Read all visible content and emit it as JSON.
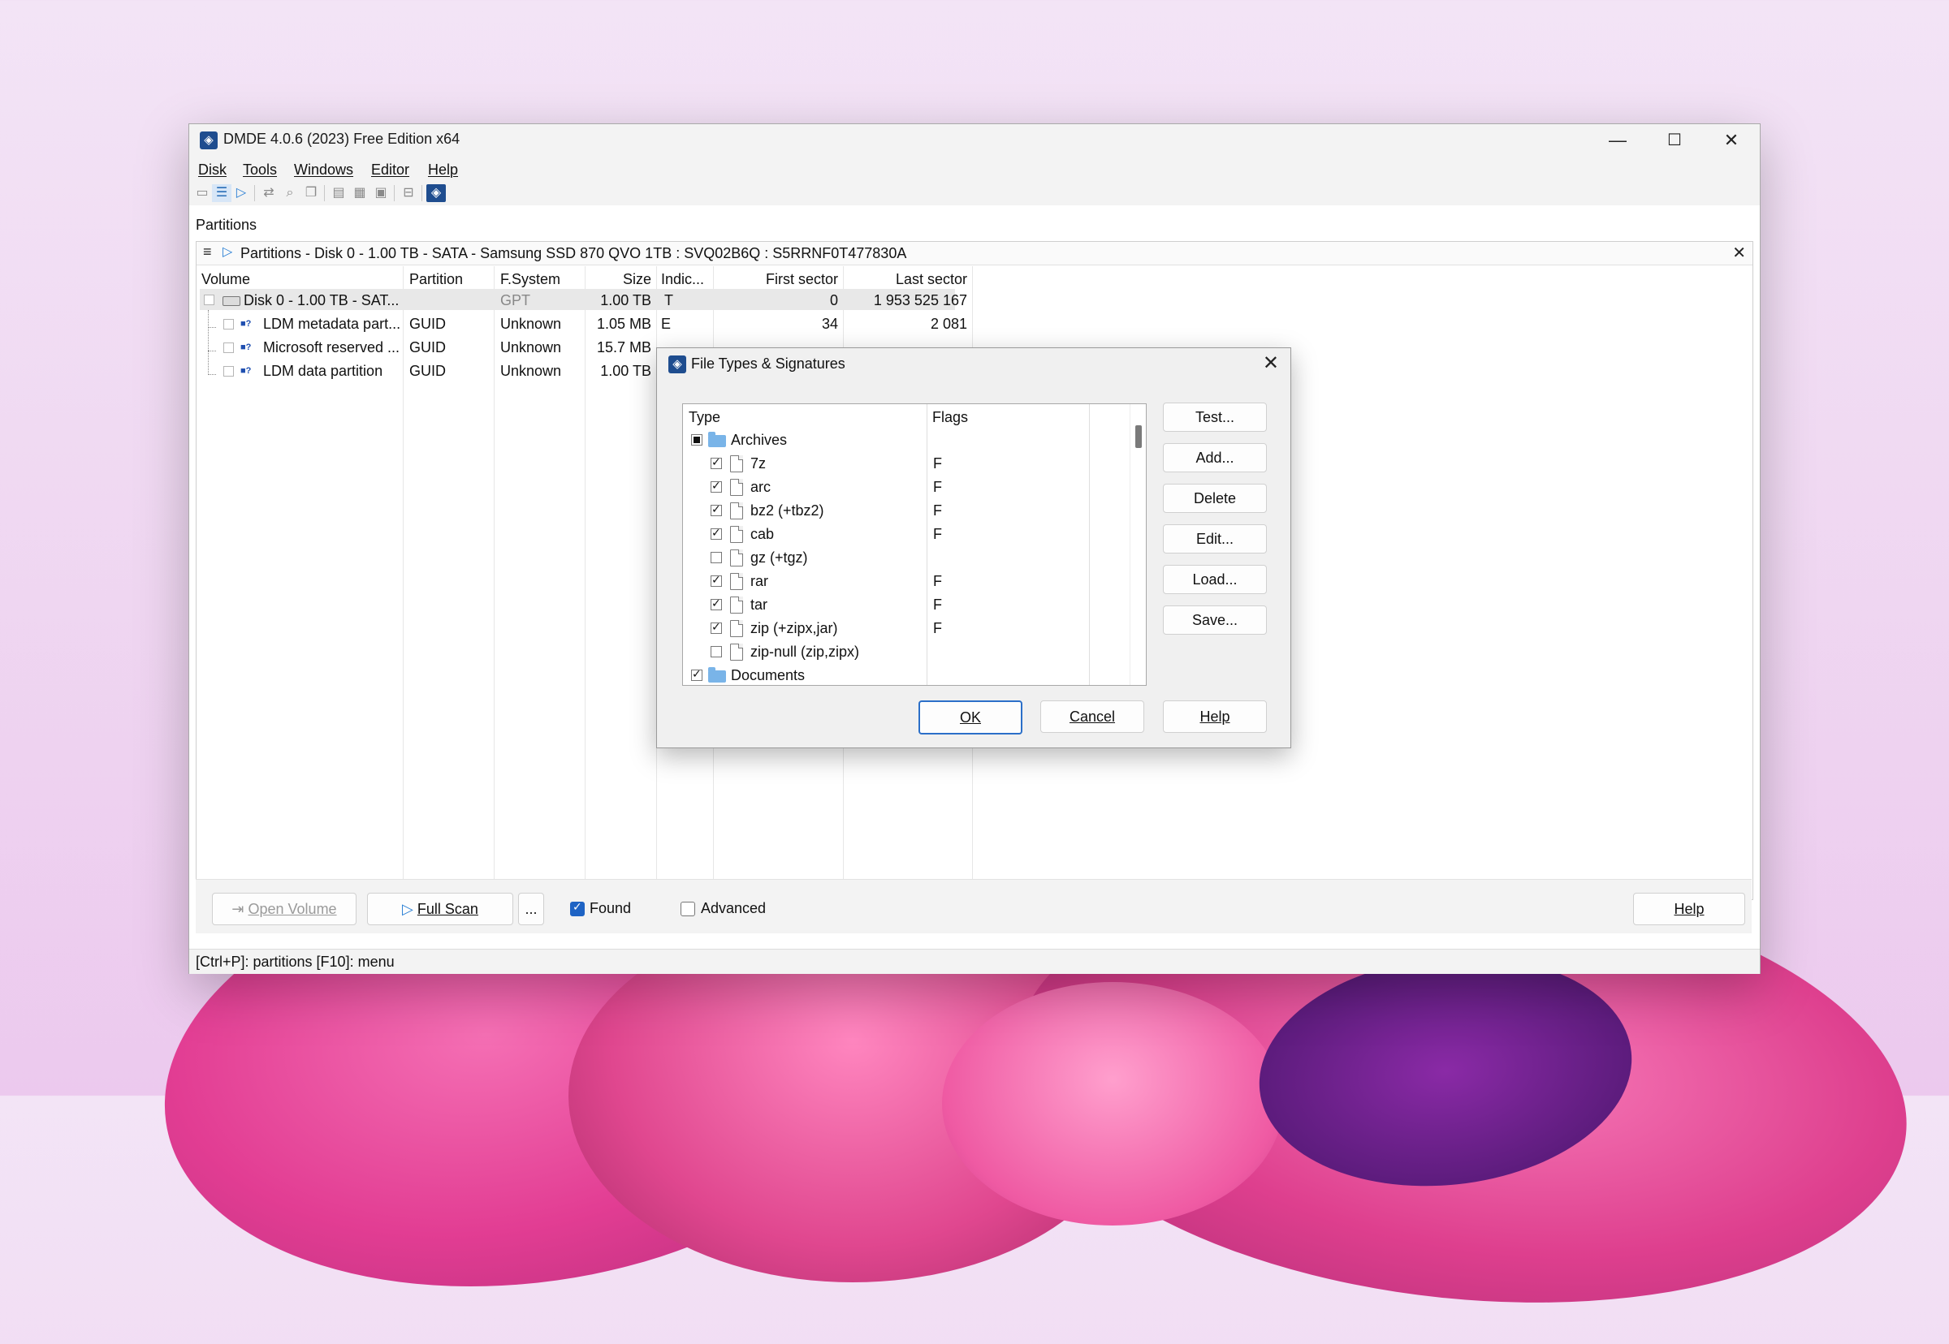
{
  "window": {
    "title": "DMDE 4.0.6 (2023) Free Edition x64",
    "controls": {
      "minimize": "—",
      "maximize": "☐",
      "close": "✕"
    }
  },
  "menu": [
    "Disk",
    "Tools",
    "Windows",
    "Editor",
    "Help"
  ],
  "section_label": "Partitions",
  "panel": {
    "menu_icon": "≡",
    "play_icon": "▷",
    "title": "Partitions - Disk 0 - 1.00 TB - SATA - Samsung SSD 870 QVO 1TB : SVQ02B6Q : S5RRNF0T477830A",
    "close": "✕"
  },
  "table": {
    "columns": [
      "Volume",
      "Partition",
      "F.System",
      "Size",
      "Indic...",
      "First sector",
      "Last sector"
    ],
    "rows": [
      {
        "volume": "Disk 0 - 1.00 TB - SAT...",
        "partition": "",
        "fs": "GPT",
        "size": "1.00 TB",
        "indic": "T",
        "first": "0",
        "last": "1 953 525 167"
      },
      {
        "volume": "LDM metadata part...",
        "partition": "GUID",
        "fs": "Unknown",
        "size": "1.05 MB",
        "indic": "E",
        "first": "34",
        "last": "2 081"
      },
      {
        "volume": "Microsoft reserved ...",
        "partition": "GUID",
        "fs": "Unknown",
        "size": "15.7 MB",
        "indic": "",
        "first": "",
        "last": ""
      },
      {
        "volume": "LDM data partition",
        "partition": "GUID",
        "fs": "Unknown",
        "size": "1.00 TB",
        "indic": "",
        "first": "",
        "last": ""
      }
    ]
  },
  "bottom": {
    "open_volume": "Open Volume",
    "full_scan": "Full Scan",
    "more": "...",
    "found": "Found",
    "found_checked": true,
    "advanced": "Advanced",
    "advanced_checked": false,
    "help": "Help"
  },
  "status": "[Ctrl+P]: partitions  [F10]: menu",
  "dialog": {
    "title": "File Types & Signatures",
    "close": "✕",
    "col_type": "Type",
    "col_flags": "Flags",
    "items": [
      {
        "label": "Archives",
        "kind": "folder",
        "state": "indeterminate",
        "flag": ""
      },
      {
        "label": "7z",
        "kind": "file",
        "state": "checked",
        "flag": "F"
      },
      {
        "label": "arc",
        "kind": "file",
        "state": "checked",
        "flag": "F"
      },
      {
        "label": "bz2 (+tbz2)",
        "kind": "file",
        "state": "checked",
        "flag": "F"
      },
      {
        "label": "cab",
        "kind": "file",
        "state": "checked",
        "flag": "F"
      },
      {
        "label": "gz (+tgz)",
        "kind": "file",
        "state": "unchecked",
        "flag": ""
      },
      {
        "label": "rar",
        "kind": "file",
        "state": "checked",
        "flag": "F"
      },
      {
        "label": "tar",
        "kind": "file",
        "state": "checked",
        "flag": "F"
      },
      {
        "label": "zip (+zipx,jar)",
        "kind": "file",
        "state": "checked",
        "flag": "F"
      },
      {
        "label": "zip-null (zip,zipx)",
        "kind": "file",
        "state": "unchecked",
        "flag": ""
      },
      {
        "label": "Documents",
        "kind": "folder",
        "state": "checked",
        "flag": ""
      }
    ],
    "side_buttons": [
      "Test...",
      "Add...",
      "Delete",
      "Edit...",
      "Load...",
      "Save..."
    ],
    "ok": "OK",
    "cancel": "Cancel",
    "help": "Help"
  }
}
